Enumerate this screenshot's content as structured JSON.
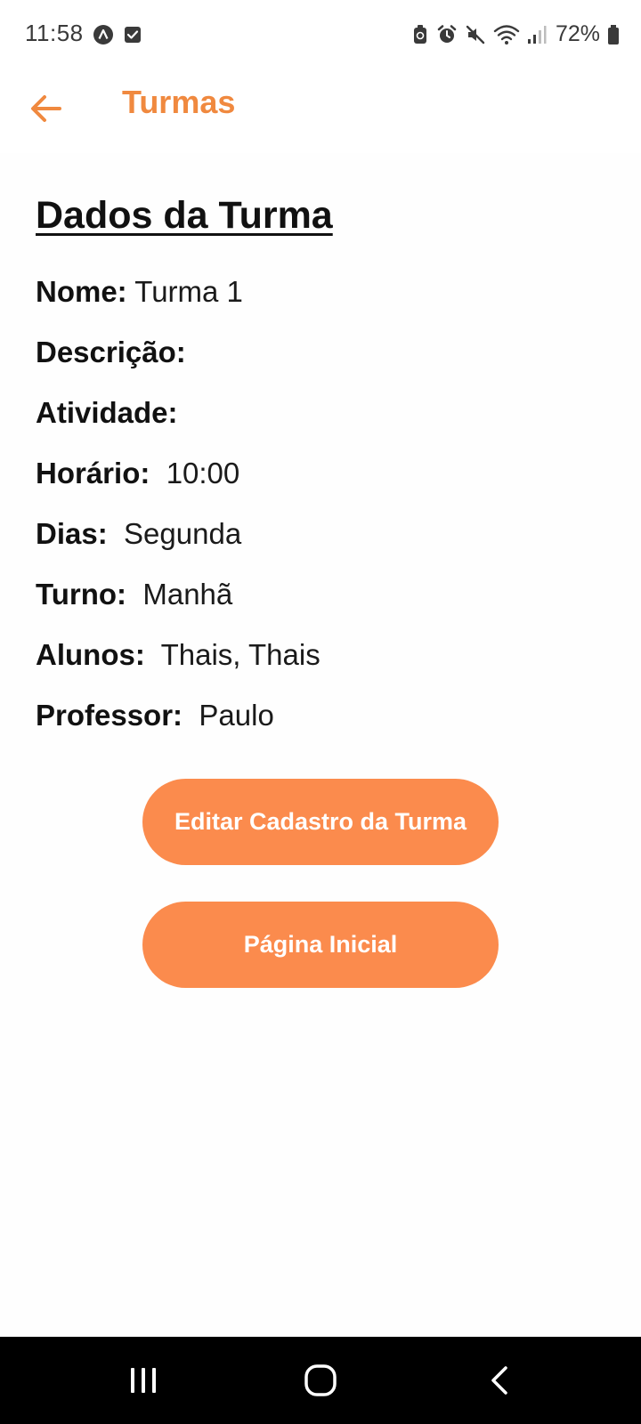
{
  "status_bar": {
    "time": "11:58",
    "battery": "72%",
    "left_icons": [
      "app-notification-icon",
      "checkbox-notification-icon"
    ],
    "right_icons": [
      "battery-saver-icon",
      "alarm-icon",
      "mute-icon",
      "wifi-icon",
      "signal-icon",
      "battery-icon"
    ]
  },
  "header": {
    "title": "Turmas",
    "back_icon": "arrow-left-icon",
    "accent_color": "#f0893f"
  },
  "details": {
    "section_title": "Dados da Turma",
    "fields": [
      {
        "label": "Nome:",
        "value": "Turma 1"
      },
      {
        "label": "Descrição:",
        "value": ""
      },
      {
        "label": "Atividade:",
        "value": ""
      },
      {
        "label": "Horário:",
        "value": "10:00"
      },
      {
        "label": "Dias:",
        "value": "Segunda"
      },
      {
        "label": "Turno:",
        "value": "Manhã"
      },
      {
        "label": "Alunos:",
        "value": "Thais, Thais"
      },
      {
        "label": "Professor:",
        "value": "Paulo"
      }
    ]
  },
  "buttons": {
    "edit_label": "Editar Cadastro da Turma",
    "home_label": "Página Inicial",
    "color": "#fb8b4d"
  },
  "nav_bar": {
    "icons": [
      "recent-apps-icon",
      "home-icon",
      "back-icon"
    ]
  }
}
